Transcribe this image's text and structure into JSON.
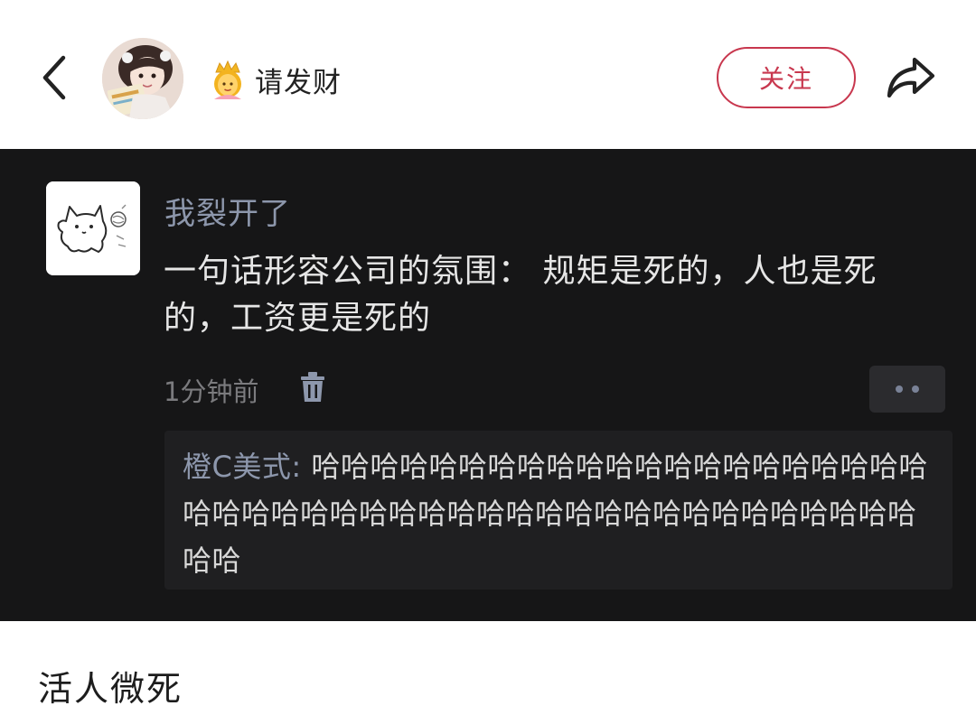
{
  "header": {
    "username": "请发财",
    "follow_label": "关注",
    "crown_icon": "crown-person-emoji",
    "accent_color": "#c8374e"
  },
  "comment": {
    "author": "我裂开了",
    "text": "一句话形容公司的氛围： 规矩是死的，人也是死的，工资更是死的",
    "time": "1分钟前",
    "reply": {
      "author": "橙C美式:",
      "text": " 哈哈哈哈哈哈哈哈哈哈哈哈哈哈哈哈哈哈哈哈哈哈哈哈哈哈哈哈哈哈哈哈哈哈哈哈哈哈哈哈哈哈哈哈哈哈哈哈"
    }
  },
  "caption": "活人微死"
}
